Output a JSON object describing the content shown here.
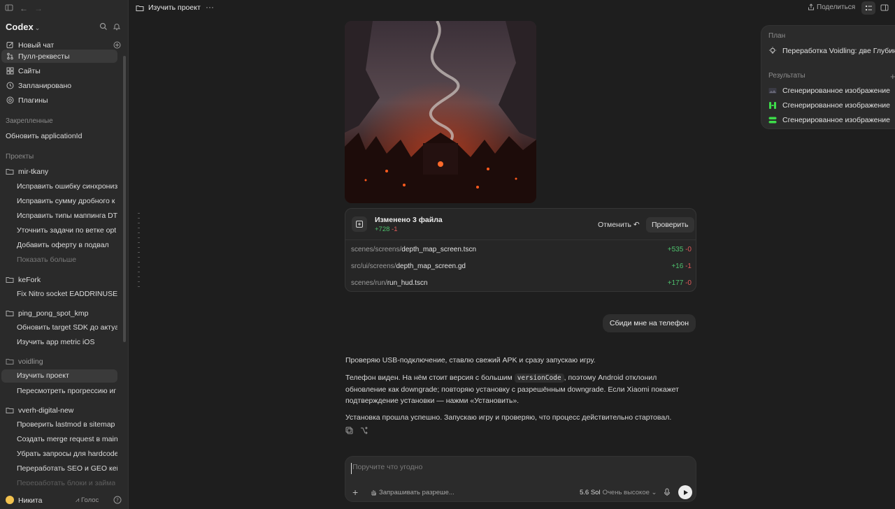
{
  "app": {
    "name": "Codex"
  },
  "sidebar": {
    "nav": [
      {
        "label": "Новый чат",
        "icon": "edit-icon"
      },
      {
        "label": "Пулл-реквесты",
        "icon": "pull-request-icon"
      },
      {
        "label": "Сайты",
        "icon": "grid-icon"
      },
      {
        "label": "Запланировано",
        "icon": "clock-icon"
      },
      {
        "label": "Плагины",
        "icon": "plugin-icon"
      }
    ],
    "pinned_header": "Закрепленные",
    "pinned": [
      {
        "label": "Обновить applicationId"
      }
    ],
    "projects_header": "Проекты",
    "projects": [
      {
        "name": "mir-tkany",
        "items": [
          "Исправить ошибку синхрониз",
          "Исправить сумму дробного к",
          "Исправить типы маппинга DT",
          "Уточнить задачи по ветке opt",
          "Добавить оферту в подвал"
        ],
        "show_more": "Показать больше"
      },
      {
        "name": "keFork",
        "items": [
          "Fix Nitro socket EADDRINUSE"
        ]
      },
      {
        "name": "ping_pong_spot_kmp",
        "items": [
          "Обновить target SDK до актуа",
          "Изучить app metric iOS"
        ]
      },
      {
        "name": "voidling",
        "items": [
          "Изучить проект",
          "Пересмотреть прогрессию иг"
        ]
      },
      {
        "name": "vverh-digital-new",
        "items": [
          "Проверить lastmod в sitemap",
          "Создать merge request в main",
          "Убрать запросы для hardcode",
          "Переработать SEO и GEO кей",
          "Переработать блоки и займа"
        ]
      }
    ],
    "user": {
      "name": "Никита",
      "voice_label": "Голос"
    }
  },
  "header": {
    "title": "Изучить проект",
    "more": "···",
    "share": "Поделиться"
  },
  "changes": {
    "title": "Изменено 3 файла",
    "added": "+728",
    "removed": "-1",
    "undo": "Отменить",
    "review": "Проверить",
    "files": [
      {
        "dir": "scenes/screens/",
        "name": "depth_map_screen.tscn",
        "added": "+535",
        "removed": "-0"
      },
      {
        "dir": "src/ui/screens/",
        "name": "depth_map_screen.gd",
        "added": "+16",
        "removed": "-1"
      },
      {
        "dir": "scenes/run/",
        "name": "run_hud.tscn",
        "added": "+177",
        "removed": "-0"
      }
    ]
  },
  "user_message": "Сбиди мне на телефон",
  "assistant": {
    "p1": "Проверяю USB-подключение, ставлю свежий APK и сразу запускаю игру.",
    "p2_a": "Телефон виден. На нём стоит версия с большим ",
    "p2_code": "versionCode",
    "p2_b": ", поэтому Android отклонил обновление как downgrade; повторяю установку с разрешённым downgrade. Если Xiaomi покажет подтверждение установки — нажми «Установить».",
    "p3": "Установка прошла успешно. Запускаю игру и проверяю, что процесс действительно стартовал."
  },
  "composer": {
    "placeholder": "Поручите что угодно",
    "permissions": "Запрашивать разреше...",
    "model": "5.6 Sol",
    "level": "Очень высокое"
  },
  "panel": {
    "plan_header": "План",
    "plan_item": "Переработка Voidling: две Глубины",
    "results_header": "Результаты",
    "results": [
      "Сгенерированное изображение",
      "Сгенерированное изображение",
      "Сгенерированное изображение"
    ]
  },
  "colors": {
    "added": "#4ec16d",
    "removed": "#e05a5a",
    "accent_green": "#3ddc4a"
  }
}
